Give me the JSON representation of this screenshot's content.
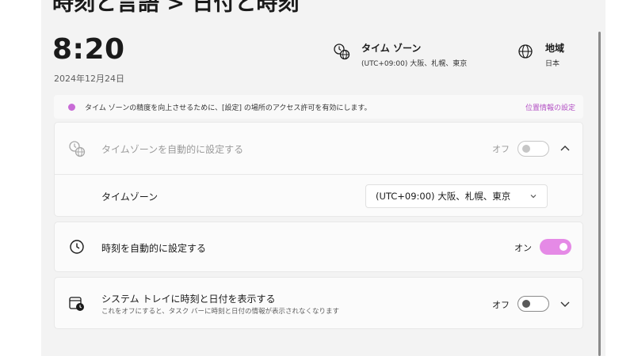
{
  "page": {
    "heading": "時刻と言語 > 日付と時刻"
  },
  "summary": {
    "time": "8:20",
    "date": "2024年12月24日",
    "timezone_title": "タイム ゾーン",
    "timezone_value": "(UTC+09:00) 大阪、札幌、東京",
    "region_title": "地域",
    "region_value": "日本"
  },
  "notice": {
    "text": "タイム ゾーンの精度を向上させるために、[設定] の場所のアクセス許可を有効にします。",
    "link": "位置情報の設定",
    "accent_color": "#c86bd6"
  },
  "auto_timezone": {
    "label": "タイムゾーンを自動的に設定する",
    "state_label": "オフ",
    "state": false,
    "disabled": true,
    "timezone_label": "タイムゾーン",
    "timezone_selected": "(UTC+09:00) 大阪、札幌、東京"
  },
  "auto_time": {
    "label": "時刻を自動的に設定する",
    "state_label": "オン",
    "state": true,
    "toggle_color": "#e58ae6"
  },
  "tray": {
    "label": "システム トレイに時刻と日付を表示する",
    "sublabel": "これをオフにすると、タスク バーに時刻と日付の情報が表示されなくなります",
    "state_label": "オフ",
    "state": false
  },
  "icons": {
    "timezone": "globe-clock-icon",
    "region": "globe-icon",
    "clock": "clock-icon",
    "tray": "calendar-clock-icon"
  }
}
